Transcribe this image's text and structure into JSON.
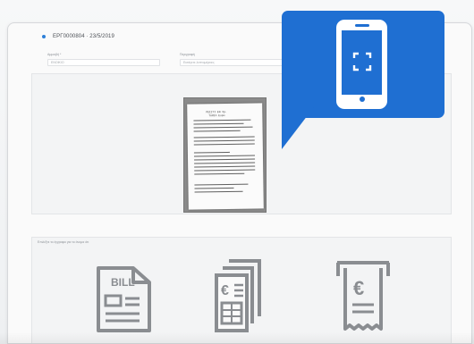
{
  "header": {
    "record_title": "ΕΡΓ0000804 · 23/5/2019"
  },
  "form": {
    "amount_label": "Αμμοιβή *",
    "amount_value": "ΕΝΟΙΚΙΟ",
    "notes_label": "Περιγραφή",
    "notes_placeholder": "Εισάγετε λεπτομέρειες"
  },
  "receipt": {
    "title_line_1": "ΡΕΣΙΤΙ ΕΝ Χρ.",
    "title_line_2": "ΤΑΜΙΑ Ευρώ"
  },
  "types": {
    "label": "Επιλέξτε το έγγραφο για το όνομα ότι",
    "bill_text": "BILL",
    "currency_symbol_1": "€",
    "currency_symbol_2": "€"
  },
  "icons": {
    "phone": "mobile-scan-icon",
    "bill": "bill-icon",
    "invoice": "invoice-stack-icon",
    "receipt": "receipt-roll-icon"
  },
  "colors": {
    "accent": "#1f6fd2",
    "icon_gray": "#8a8d91"
  }
}
